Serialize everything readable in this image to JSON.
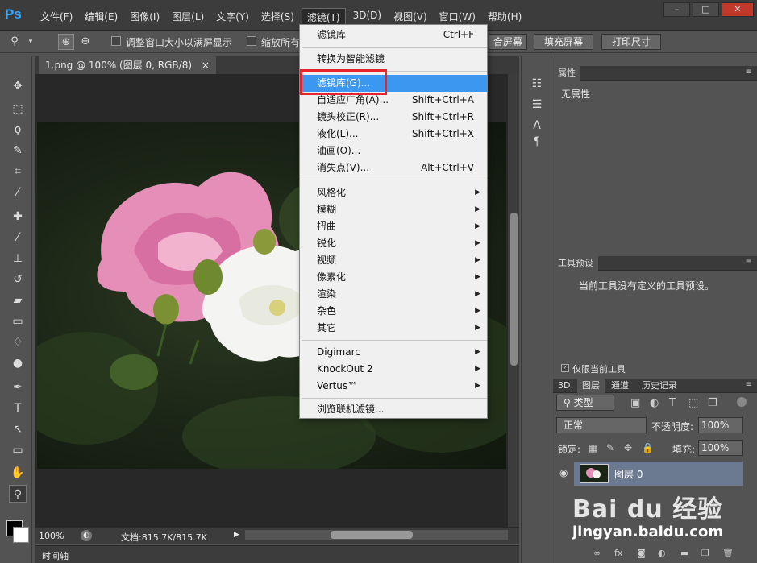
{
  "app": {
    "logo": "Ps"
  },
  "menubar": {
    "items": [
      "文件(F)",
      "编辑(E)",
      "图像(I)",
      "图层(L)",
      "文字(Y)",
      "选择(S)",
      "滤镜(T)",
      "3D(D)",
      "视图(V)",
      "窗口(W)",
      "帮助(H)"
    ],
    "active_index": 6,
    "window_buttons": [
      "–",
      "□",
      "✕"
    ]
  },
  "options": {
    "check1_label": "调整窗口大小以满屏显示",
    "check2_label": "缩放所有",
    "btn_fit": "合屏幕",
    "btn_fill": "填充屏幕",
    "btn_print": "打印尺寸"
  },
  "document": {
    "tab_label": "1.png @ 100% (图层 0, RGB/8)",
    "tab_close": "×",
    "zoom": "100%",
    "doc_info": "文档:815.7K/815.7K"
  },
  "timeline": {
    "label": "时间轴"
  },
  "filter_menu": {
    "items": [
      {
        "label": "滤镜库",
        "shortcut": "Ctrl+F"
      },
      {
        "label": "转换为智能滤镜",
        "shortcut": ""
      },
      {
        "label": "滤镜库(G)...",
        "shortcut": ""
      },
      {
        "label": "自适应广角(A)...",
        "shortcut": "Shift+Ctrl+A"
      },
      {
        "label": "镜头校正(R)...",
        "shortcut": "Shift+Ctrl+R"
      },
      {
        "label": "液化(L)...",
        "shortcut": "Shift+Ctrl+X"
      },
      {
        "label": "油画(O)...",
        "shortcut": ""
      },
      {
        "label": "消失点(V)...",
        "shortcut": "Alt+Ctrl+V"
      },
      {
        "label": "风格化",
        "shortcut": ""
      },
      {
        "label": "模糊",
        "shortcut": ""
      },
      {
        "label": "扭曲",
        "shortcut": ""
      },
      {
        "label": "锐化",
        "shortcut": ""
      },
      {
        "label": "视频",
        "shortcut": ""
      },
      {
        "label": "像素化",
        "shortcut": ""
      },
      {
        "label": "渲染",
        "shortcut": ""
      },
      {
        "label": "杂色",
        "shortcut": ""
      },
      {
        "label": "其它",
        "shortcut": ""
      },
      {
        "label": "Digimarc",
        "shortcut": ""
      },
      {
        "label": "KnockOut 2",
        "shortcut": ""
      },
      {
        "label": "Vertus™",
        "shortcut": ""
      },
      {
        "label": "浏览联机滤镜...",
        "shortcut": ""
      }
    ],
    "submenu_arrow": "▶"
  },
  "properties": {
    "tab": "属性",
    "content": "无属性"
  },
  "tool_presets": {
    "tab": "工具预设",
    "content": "当前工具没有定义的工具预设。",
    "only_current": "仅限当前工具"
  },
  "layers": {
    "tabs": [
      "3D",
      "图层",
      "通道",
      "历史记录"
    ],
    "active_tab": 1,
    "filter_kind": "类型",
    "blend_mode": "正常",
    "opacity_label": "不透明度:",
    "opacity_value": "100%",
    "lock_label": "锁定:",
    "fill_label": "填充:",
    "fill_value": "100%",
    "layer_name": "图层 0"
  },
  "watermark": {
    "logo": "Bai du 经验",
    "url": "jingyan.baidu.com"
  },
  "colors": {
    "accent_highlight": "#3c97f0",
    "red_box": "#e5252b",
    "ps_blue": "#31a8ff"
  }
}
